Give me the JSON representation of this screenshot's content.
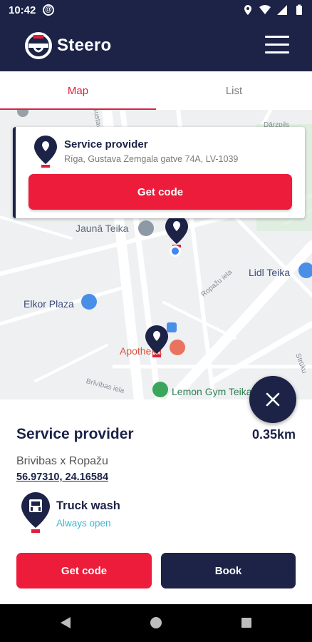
{
  "status_bar": {
    "time": "10:42",
    "icons": [
      "at-sign-icon",
      "location-icon",
      "wifi-icon",
      "signal-icon",
      "battery-icon"
    ]
  },
  "app": {
    "brand": "Steero",
    "menu_icon": "hamburger-menu-icon"
  },
  "tabs": [
    {
      "label": "Map",
      "active": true
    },
    {
      "label": "List",
      "active": false
    }
  ],
  "map": {
    "labels": {
      "jauna_teika": "Jaunā Teika",
      "lidl_teika": "Lidl Teika",
      "elkor_plaza": "Elkor Plaza",
      "apotheka": "Apotheka",
      "lemon_gym": "Lemon Gym Teika"
    },
    "streets": {
      "ropazu": "Ropažu iela",
      "brivibas": "Brīvības iela",
      "ustu": "Gustava",
      "darzpils": "Dārzpils",
      "struku": "Strūku"
    },
    "info_card": {
      "title": "Service provider",
      "address": "Rīga, Gustava Zemgala gatve 74A, LV-1039",
      "button": "Get code"
    }
  },
  "sheet": {
    "title": "Service provider",
    "distance": "0.35km",
    "address": "Brivibas x Ropažu",
    "coordinates": "56.97310, 24.16584",
    "service": {
      "name": "Truck wash",
      "status": "Always open",
      "icon": "truck-wash-icon"
    },
    "buttons": {
      "get_code": "Get code",
      "book": "Book"
    }
  },
  "colors": {
    "navy": "#1c2347",
    "red": "#ec1c3a",
    "teal": "#3fb5d3"
  }
}
